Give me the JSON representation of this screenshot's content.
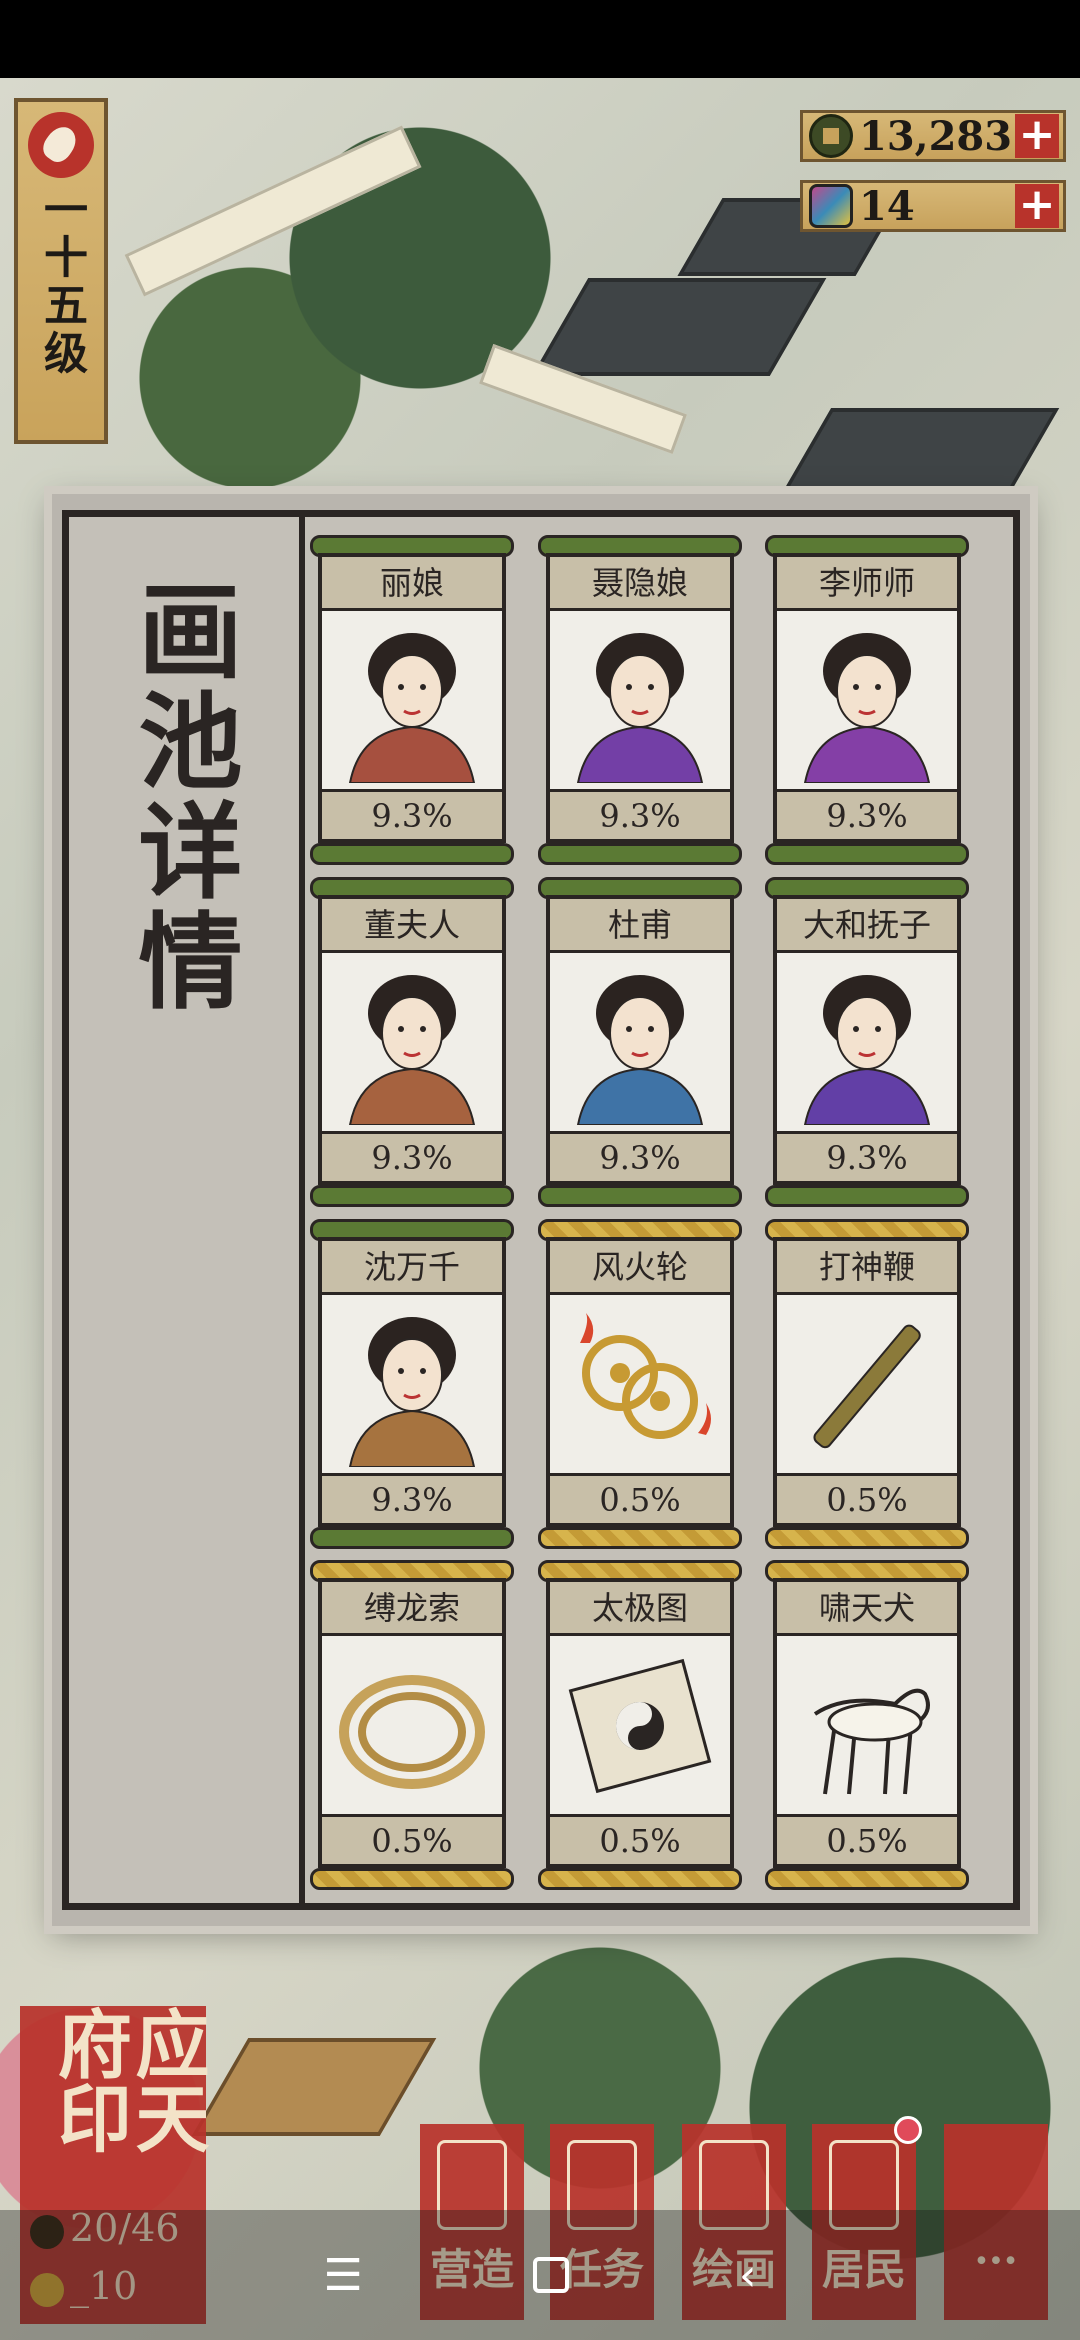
{
  "hud": {
    "level_label": "一十五级",
    "currencies": [
      {
        "name": "coin-icon",
        "value": "13,283",
        "plus": "+"
      },
      {
        "name": "gem-icon",
        "value": "14",
        "plus": "+"
      }
    ]
  },
  "pool": {
    "title": "画池详情",
    "cards": [
      {
        "name": "丽娘",
        "rate": "9.3%",
        "tier": "green"
      },
      {
        "name": "聂隐娘",
        "rate": "9.3%",
        "tier": "green"
      },
      {
        "name": "李师师",
        "rate": "9.3%",
        "tier": "green"
      },
      {
        "name": "董夫人",
        "rate": "9.3%",
        "tier": "green"
      },
      {
        "name": "杜甫",
        "rate": "9.3%",
        "tier": "green"
      },
      {
        "name": "大和抚子",
        "rate": "9.3%",
        "tier": "green"
      },
      {
        "name": "沈万千",
        "rate": "9.3%",
        "tier": "green"
      },
      {
        "name": "风火轮",
        "rate": "0.5%",
        "tier": "gold"
      },
      {
        "name": "打神鞭",
        "rate": "0.5%",
        "tier": "gold"
      },
      {
        "name": "缚龙索",
        "rate": "0.5%",
        "tier": "gold"
      },
      {
        "name": "太极图",
        "rate": "0.5%",
        "tier": "gold"
      },
      {
        "name": "啸天犬",
        "rate": "0.5%",
        "tier": "gold"
      }
    ]
  },
  "city": {
    "name": "应天府印",
    "population": "20/46",
    "coins": "_10"
  },
  "menu": [
    {
      "label": "营造"
    },
    {
      "label": "任务"
    },
    {
      "label": "绘画"
    },
    {
      "label": "居民"
    },
    {
      "label": "···"
    }
  ],
  "nav": {
    "menu": "☰",
    "back": "‹"
  }
}
